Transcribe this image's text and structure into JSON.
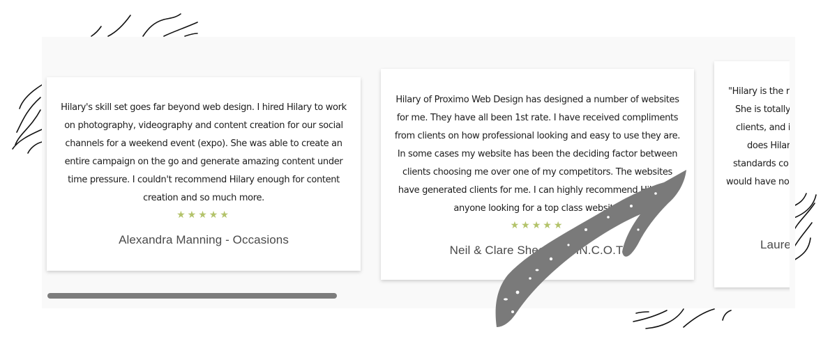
{
  "testimonials": {
    "cards": [
      {
        "quote": "Hilary's skill set goes far beyond web design. I hired Hilary to work on photography, videography and content creation for our social channels for a weekend event (expo). She was able to create an entire campaign on the go and generate amazing content under time pressure. I couldn't recommend Hilary enough for content creation and so much more.",
        "rating": 5,
        "stars": "★★★★★",
        "author": "Alexandra Manning - Occasions"
      },
      {
        "quote": "Hilary of Proximo Web Design has designed a number of websites for me. They have all been 1st rate. I have received compliments from clients on how professional looking and easy to use they are. In some cases my website has been the deciding factor between clients choosing me over one of my competitors. The websites have generated clients for me. I can highly recommend Hilary to anyone looking for a top class website.",
        "rating": 5,
        "stars": "★★★★★",
        "author": "Neil & Clare Sheehan - IN.C.O.T."
      },
      {
        "quote_visible_lines": [
          "\"Hilary is the r",
          "She is totally",
          "clients, and i",
          "does Hilar",
          "standards co",
          "would have no"
        ],
        "author_visible": "Laure"
      }
    ],
    "scroll_position_fraction": 0.0,
    "scroll_visible_fraction": 0.39
  },
  "colors": {
    "star": "#b3c36a",
    "panel_bg": "#f9f9f9",
    "scroll_thumb": "#7d7d7d",
    "arrow": "#7a7a7a"
  }
}
